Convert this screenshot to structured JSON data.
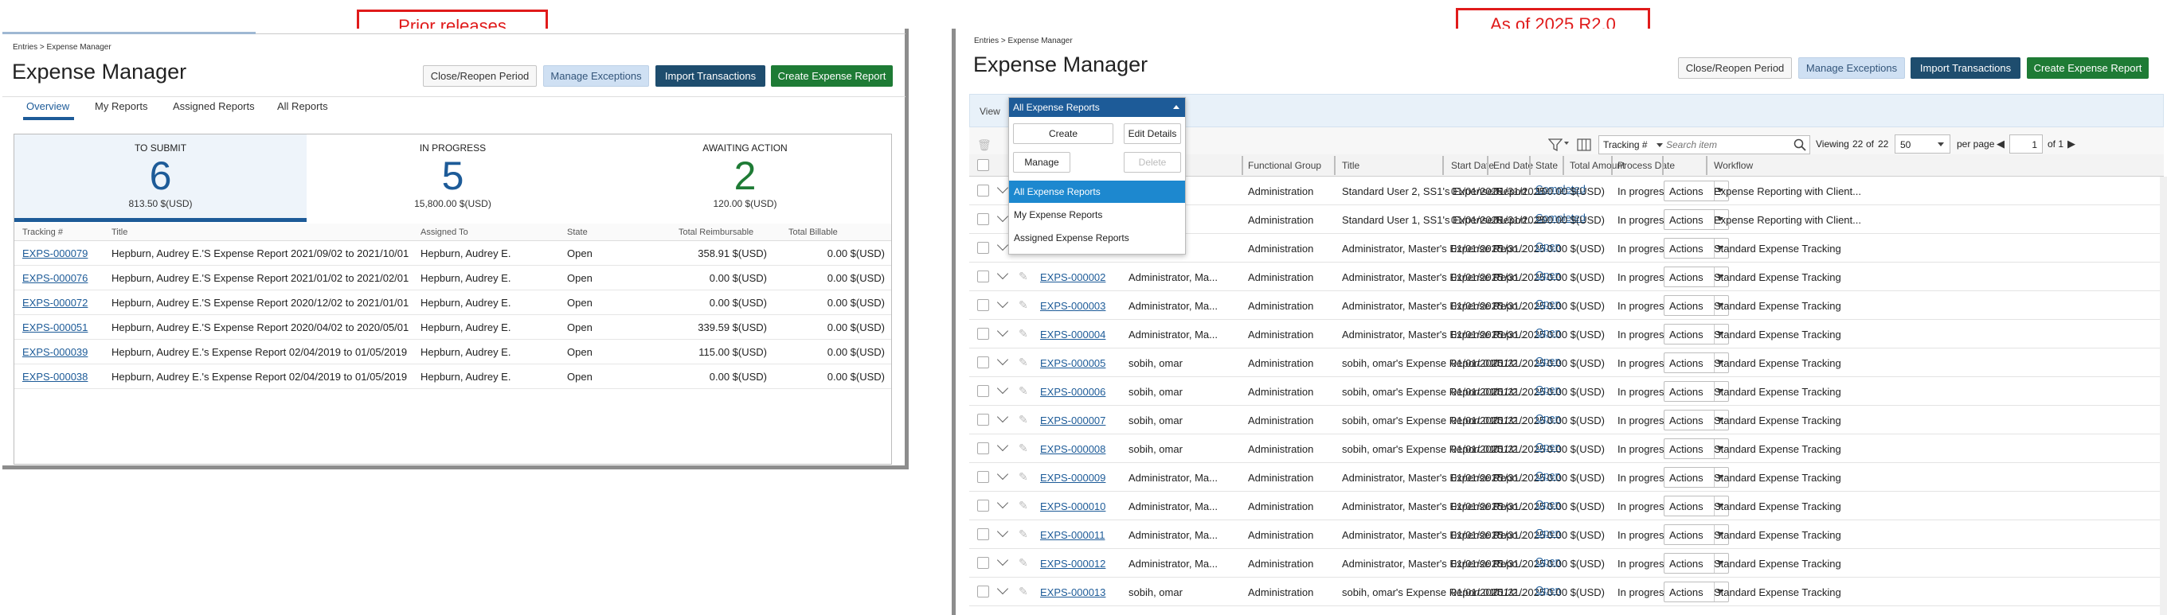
{
  "callouts": {
    "left": "Prior releases",
    "right": "As of 2025 R2.0"
  },
  "colors": {
    "callout": "#e01b1b",
    "link": "#1d5b98",
    "submit": "#1d5b98",
    "progress": "#1d5b98",
    "awaiting": "#1e7b35",
    "add": "#1e7b35",
    "header_blue": "#1e4d6e"
  },
  "prior": {
    "breadcrumb": "Entries > Expense Manager",
    "title": "Expense Manager",
    "buttons": {
      "close": "Close/Reopen Period",
      "exceptions": "Manage Exceptions",
      "import": "Import Transactions",
      "create": "Create Expense Report"
    },
    "tabs": [
      "Overview",
      "My Reports",
      "Assigned Reports",
      "All Reports"
    ],
    "summary": [
      {
        "label": "TO SUBMIT",
        "count": "6",
        "amount": "813.50 $(USD)"
      },
      {
        "label": "IN PROGRESS",
        "count": "5",
        "amount": "15,800.00 $(USD)"
      },
      {
        "label": "AWAITING ACTION",
        "count": "2",
        "amount": "120.00 $(USD)"
      }
    ],
    "columns": [
      "Tracking #",
      "Title",
      "Assigned To",
      "State",
      "Total Reimbursable",
      "Total Billable"
    ],
    "rows": [
      {
        "tracking": "EXPS-000079",
        "title": "Hepburn, Audrey E.'S Expense Report 2021/09/02 to 2021/10/01",
        "assigned": "Hepburn, Audrey E.",
        "state": "Open",
        "reimb": "358.91 $(USD)",
        "bill": "0.00 $(USD)"
      },
      {
        "tracking": "EXPS-000076",
        "title": "Hepburn, Audrey E.'S Expense Report 2021/01/02 to 2021/02/01",
        "assigned": "Hepburn, Audrey E.",
        "state": "Open",
        "reimb": "0.00 $(USD)",
        "bill": "0.00 $(USD)"
      },
      {
        "tracking": "EXPS-000072",
        "title": "Hepburn, Audrey E.'S Expense Report 2020/12/02 to 2021/01/01",
        "assigned": "Hepburn, Audrey E.",
        "state": "Open",
        "reimb": "0.00 $(USD)",
        "bill": "0.00 $(USD)"
      },
      {
        "tracking": "EXPS-000051",
        "title": "Hepburn, Audrey E.'S Expense Report 2020/04/02 to 2020/05/01",
        "assigned": "Hepburn, Audrey E.",
        "state": "Open",
        "reimb": "339.59 $(USD)",
        "bill": "0.00 $(USD)"
      },
      {
        "tracking": "EXPS-000039",
        "title": "Hepburn, Audrey E.'s Expense Report 02/04/2019 to 01/05/2019",
        "assigned": "Hepburn, Audrey E.",
        "state": "Open",
        "reimb": "115.00 $(USD)",
        "bill": "0.00 $(USD)"
      },
      {
        "tracking": "EXPS-000038",
        "title": "Hepburn, Audrey E.'s Expense Report 02/04/2019 to 01/05/2019",
        "assigned": "Hepburn, Audrey E.",
        "state": "Open",
        "reimb": "0.00 $(USD)",
        "bill": "0.00 $(USD)"
      }
    ]
  },
  "current": {
    "breadcrumb": "Entries > Expense Manager",
    "title": "Expense Manager",
    "buttons": {
      "close": "Close/Reopen Period",
      "exceptions": "Manage Exceptions",
      "import": "Import Transactions",
      "create": "Create Expense Report"
    },
    "view_label": "View",
    "view_selected": "All Expense Reports",
    "popup": {
      "create": "Create",
      "edit": "Edit Details",
      "manage": "Manage",
      "delete": "Delete",
      "options": [
        "All Expense Reports",
        "My Expense Reports",
        "Assigned Expense Reports"
      ]
    },
    "search": {
      "field": "Tracking #",
      "placeholder": "Search item"
    },
    "viewing": {
      "label": "Viewing",
      "shown": "22",
      "of": "of",
      "total": "22"
    },
    "per_page": {
      "value": "50",
      "label": "per page"
    },
    "page": {
      "current": "1",
      "of_label": "of 1"
    },
    "columns": [
      "Functional Group",
      "Title",
      "Start Date",
      "End Date",
      "State",
      "Total Amount",
      "Process Date",
      "Workflow"
    ],
    "rows": [
      {
        "tracking": "",
        "assigned": "",
        "group": "Administration",
        "title": "Standard User 2, SS1's Expense Report...",
        "start": "01/01/2025",
        "end": "01/31/2025",
        "state": "Completed",
        "amount": "100.00 $(USD)",
        "process": "In progress",
        "action": "Actions",
        "workflow": "Expense Reporting with Client..."
      },
      {
        "tracking": "",
        "assigned": "",
        "group": "Administration",
        "title": "Standard User 1, SS1's Expense Report...",
        "start": "01/01/2025",
        "end": "01/31/2025",
        "state": "Completed",
        "amount": "200.00 $(USD)",
        "process": "In progress",
        "action": "Actions",
        "workflow": "Expense Reporting with Client..."
      },
      {
        "tracking": "",
        "assigned": "",
        "group": "Administration",
        "title": "Administrator, Master's Expense Repo...",
        "start": "01/01/2025",
        "end": "01/31/2025",
        "state": "Open",
        "amount": "0.00 $(USD)",
        "process": "In progress",
        "action": "Actions",
        "workflow": "Standard Expense Tracking"
      },
      {
        "tracking": "EXPS-000002",
        "assigned": "Administrator, Ma...",
        "group": "Administration",
        "title": "Administrator, Master's Expense Repo...",
        "start": "01/01/2025",
        "end": "01/31/2025",
        "state": "Open",
        "amount": "0.00 $(USD)",
        "process": "In progress",
        "action": "Actions",
        "workflow": "Standard Expense Tracking"
      },
      {
        "tracking": "EXPS-000003",
        "assigned": "Administrator, Ma...",
        "group": "Administration",
        "title": "Administrator, Master's Expense Repo...",
        "start": "01/01/2025",
        "end": "01/31/2025",
        "state": "Open",
        "amount": "0.00 $(USD)",
        "process": "In progress",
        "action": "Actions",
        "workflow": "Standard Expense Tracking"
      },
      {
        "tracking": "EXPS-000004",
        "assigned": "Administrator, Ma...",
        "group": "Administration",
        "title": "Administrator, Master's Expense Repo...",
        "start": "01/01/2025",
        "end": "01/31/2025",
        "state": "Open",
        "amount": "0.00 $(USD)",
        "process": "In progress",
        "action": "Actions",
        "workflow": "Standard Expense Tracking"
      },
      {
        "tracking": "EXPS-000005",
        "assigned": "sobih, omar",
        "group": "Administration",
        "title": "sobih, omar's Expense Report 01/01/2...",
        "start": "01/01/2025",
        "end": "01/31/2025",
        "state": "Open",
        "amount": "0.00 $(USD)",
        "process": "In progress",
        "action": "Actions",
        "workflow": "Standard Expense Tracking"
      },
      {
        "tracking": "EXPS-000006",
        "assigned": "sobih, omar",
        "group": "Administration",
        "title": "sobih, omar's Expense Report 01/01/2...",
        "start": "01/01/2025",
        "end": "01/31/2025",
        "state": "Open",
        "amount": "0.00 $(USD)",
        "process": "In progress",
        "action": "Actions",
        "workflow": "Standard Expense Tracking"
      },
      {
        "tracking": "EXPS-000007",
        "assigned": "sobih, omar",
        "group": "Administration",
        "title": "sobih, omar's Expense Report 01/01/2...",
        "start": "01/01/2025",
        "end": "01/31/2025",
        "state": "Open",
        "amount": "0.00 $(USD)",
        "process": "In progress",
        "action": "Actions",
        "workflow": "Standard Expense Tracking"
      },
      {
        "tracking": "EXPS-000008",
        "assigned": "sobih, omar",
        "group": "Administration",
        "title": "sobih, omar's Expense Report 01/01/2...",
        "start": "01/01/2025",
        "end": "01/31/2025",
        "state": "Open",
        "amount": "0.00 $(USD)",
        "process": "In progress",
        "action": "Actions",
        "workflow": "Standard Expense Tracking"
      },
      {
        "tracking": "EXPS-000009",
        "assigned": "Administrator, Ma...",
        "group": "Administration",
        "title": "Administrator, Master's Expense Repo...",
        "start": "01/01/2025",
        "end": "01/31/2025",
        "state": "Open",
        "amount": "0.00 $(USD)",
        "process": "In progress",
        "action": "Actions",
        "workflow": "Standard Expense Tracking"
      },
      {
        "tracking": "EXPS-000010",
        "assigned": "Administrator, Ma...",
        "group": "Administration",
        "title": "Administrator, Master's Expense Repo...",
        "start": "01/01/2025",
        "end": "01/31/2025",
        "state": "Open",
        "amount": "0.00 $(USD)",
        "process": "In progress",
        "action": "Actions",
        "workflow": "Standard Expense Tracking"
      },
      {
        "tracking": "EXPS-000011",
        "assigned": "Administrator, Ma...",
        "group": "Administration",
        "title": "Administrator, Master's Expense Repo...",
        "start": "01/01/2025",
        "end": "01/31/2025",
        "state": "Open",
        "amount": "0.00 $(USD)",
        "process": "In progress",
        "action": "Actions",
        "workflow": "Standard Expense Tracking"
      },
      {
        "tracking": "EXPS-000012",
        "assigned": "Administrator, Ma...",
        "group": "Administration",
        "title": "Administrator, Master's Expense Repo...",
        "start": "01/01/2025",
        "end": "01/31/2025",
        "state": "Open",
        "amount": "0.00 $(USD)",
        "process": "In progress",
        "action": "Actions",
        "workflow": "Standard Expense Tracking"
      },
      {
        "tracking": "EXPS-000013",
        "assigned": "sobih, omar",
        "group": "Administration",
        "title": "sobih, omar's Expense Report 01/01/2...",
        "start": "01/01/2025",
        "end": "01/31/2025",
        "state": "Open",
        "amount": "0.00 $(USD)",
        "process": "In progress",
        "action": "Actions",
        "workflow": "Standard Expense Tracking"
      }
    ]
  }
}
